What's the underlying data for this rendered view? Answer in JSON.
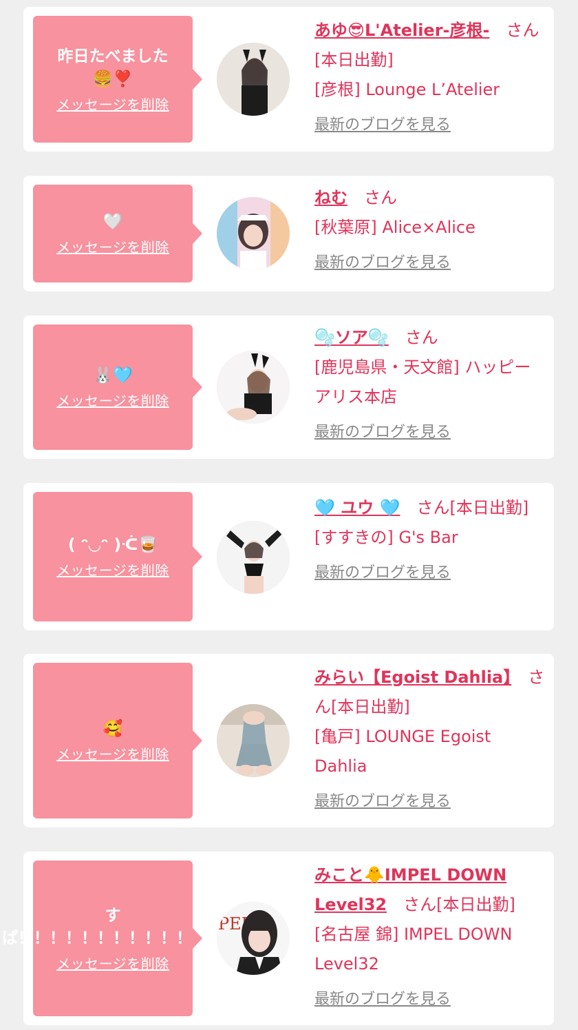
{
  "delete_label": "メッセージを削除",
  "blog_label": "最新のブログを見る",
  "honorific": "さん",
  "cards": [
    {
      "message": "昨日たべました🍔❣️",
      "name": "あゆ😎L'Atelier-彦根-",
      "status": "[本日出勤]",
      "shop": "[彦根] Lounge L’Atelier"
    },
    {
      "message": "🤍",
      "name": "ねむ",
      "status": "",
      "shop": "[秋葉原] Alice×Alice"
    },
    {
      "message": "🐰🩵",
      "name": "🫧ソア🫧",
      "status": "",
      "shop": "[鹿児島県・天文館] ハッピーアリス本店"
    },
    {
      "message": "( ᵔ◡ᵔ )ᑣ🥃",
      "name": "🩵 ユウ 🩵",
      "status": "[本日出勤]",
      "shop": "[すすきの] G's Bar"
    },
    {
      "message": "🥰",
      "name": "みらい【Egoist Dahlia】",
      "status": "[本日出勤]",
      "shop": "[亀戸] LOUNGE Egoist Dahlia"
    },
    {
      "message": "すぱ！！！！！！！！！！！！！",
      "name": "みこと🐥IMPEL DOWN Level32",
      "status": "[本日出勤]",
      "shop": "[名古屋 錦] IMPEL DOWN Level32"
    }
  ],
  "colors": {
    "accent": "#e0345a",
    "bubble": "#f7929e",
    "background": "#efefef"
  }
}
